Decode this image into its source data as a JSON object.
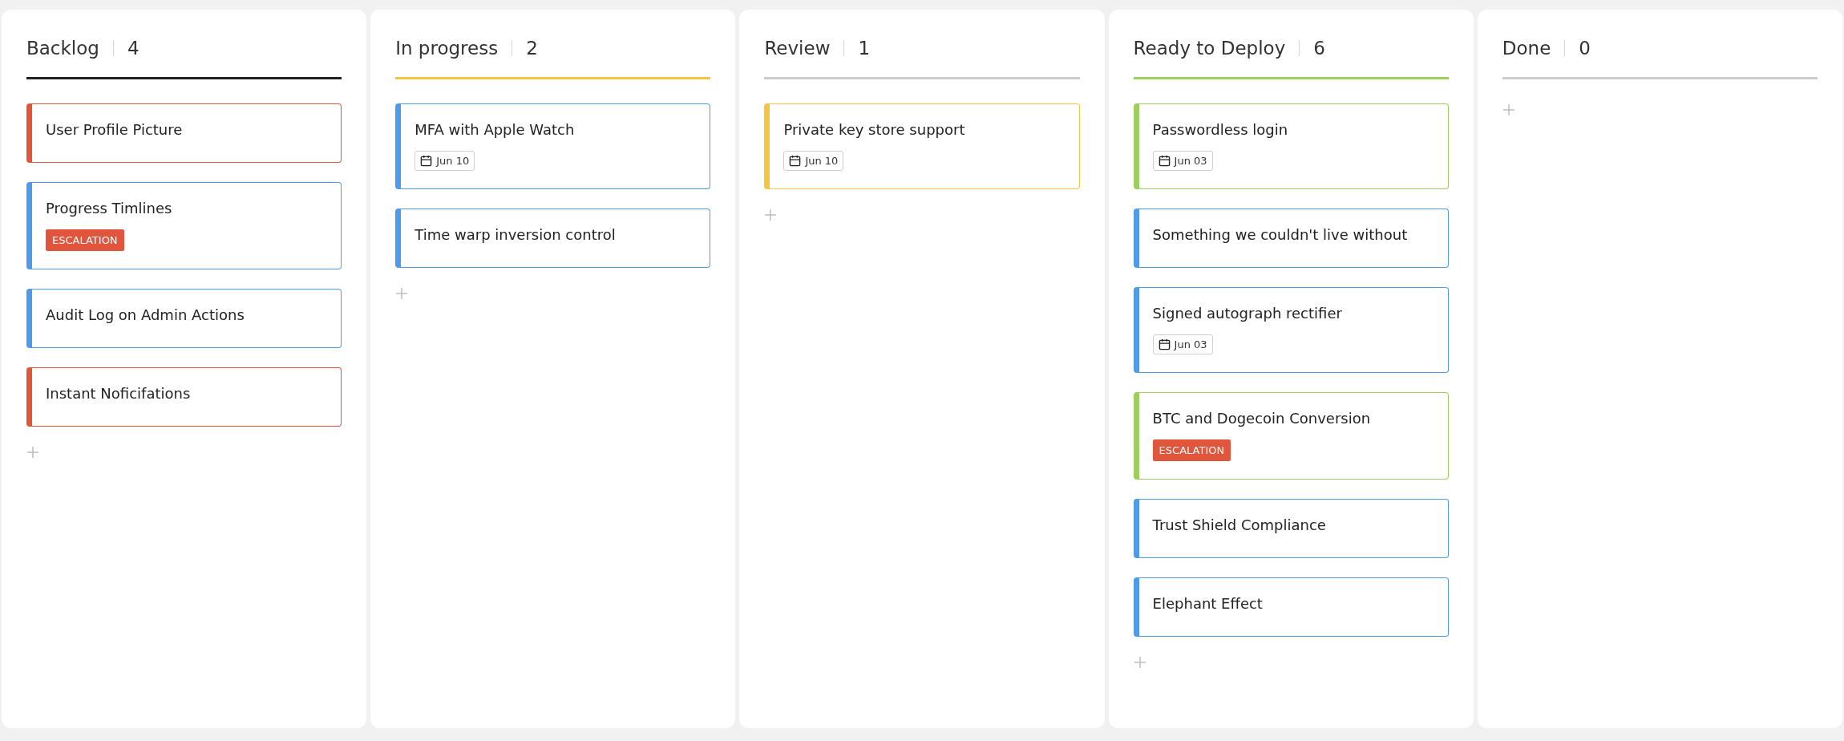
{
  "columns": [
    {
      "title": "Backlog",
      "count": "4",
      "color": "#222222",
      "cards": [
        {
          "title": "User Profile Picture",
          "color": "#e0553b"
        },
        {
          "title": "Progress Timlines",
          "color": "#4f9be8",
          "tag": "ESCALATION"
        },
        {
          "title": "Audit Log on Admin Actions",
          "color": "#4f9be8"
        },
        {
          "title": "Instant Noficifations",
          "color": "#e0553b"
        }
      ]
    },
    {
      "title": "In progress",
      "count": "2",
      "color": "#f5c542",
      "cards": [
        {
          "title": "MFA with Apple Watch",
          "color": "#4f9be8",
          "date": "Jun 10"
        },
        {
          "title": "Time warp inversion control",
          "color": "#4f9be8"
        }
      ]
    },
    {
      "title": "Review",
      "count": "1",
      "color": "#cccccc",
      "cards": [
        {
          "title": "Private key store support",
          "color": "#f5c542",
          "date": "Jun 10"
        }
      ]
    },
    {
      "title": "Ready to Deploy",
      "count": "6",
      "color": "#9ccf5e",
      "cards": [
        {
          "title": "Passwordless login",
          "color": "#9ccf5e",
          "date": "Jun 03"
        },
        {
          "title": "Something we couldn't live without",
          "color": "#4f9be8"
        },
        {
          "title": "Signed autograph rectifier",
          "color": "#4f9be8",
          "date": "Jun 03"
        },
        {
          "title": "BTC and Dogecoin Conversion",
          "color": "#9ccf5e",
          "tag": "ESCALATION"
        },
        {
          "title": "Trust Shield Compliance",
          "color": "#4f9be8"
        },
        {
          "title": "Elephant Effect",
          "color": "#4f9be8"
        }
      ]
    },
    {
      "title": "Done",
      "count": "0",
      "color": "#cccccc"
    }
  ]
}
